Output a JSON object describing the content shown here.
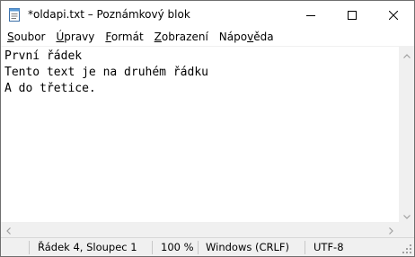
{
  "window": {
    "title": "*oldapi.txt – Poznámkový blok",
    "icon": "notepad-icon"
  },
  "caption_buttons": {
    "minimize": "minimize-icon",
    "maximize": "maximize-icon",
    "close": "close-icon"
  },
  "menu": {
    "items": [
      {
        "accel": "S",
        "rest": "oubor"
      },
      {
        "accel": "Ú",
        "rest": "pravy"
      },
      {
        "accel": "F",
        "rest": "ormát"
      },
      {
        "accel": "Z",
        "rest": "obrazení"
      },
      {
        "pre": "Nápo",
        "accel": "v",
        "rest": "ěda"
      }
    ]
  },
  "editor": {
    "lines": [
      "První řádek",
      "Tento text je na druhém řádku",
      "A do třetice."
    ]
  },
  "statusbar": {
    "position": "Řádek 4, Sloupec 1",
    "zoom": "100 %",
    "line_ending": "Windows (CRLF)",
    "encoding": "UTF-8"
  },
  "colors": {
    "chrome": "#f0f0f0",
    "arrow": "#a0a0a0"
  }
}
